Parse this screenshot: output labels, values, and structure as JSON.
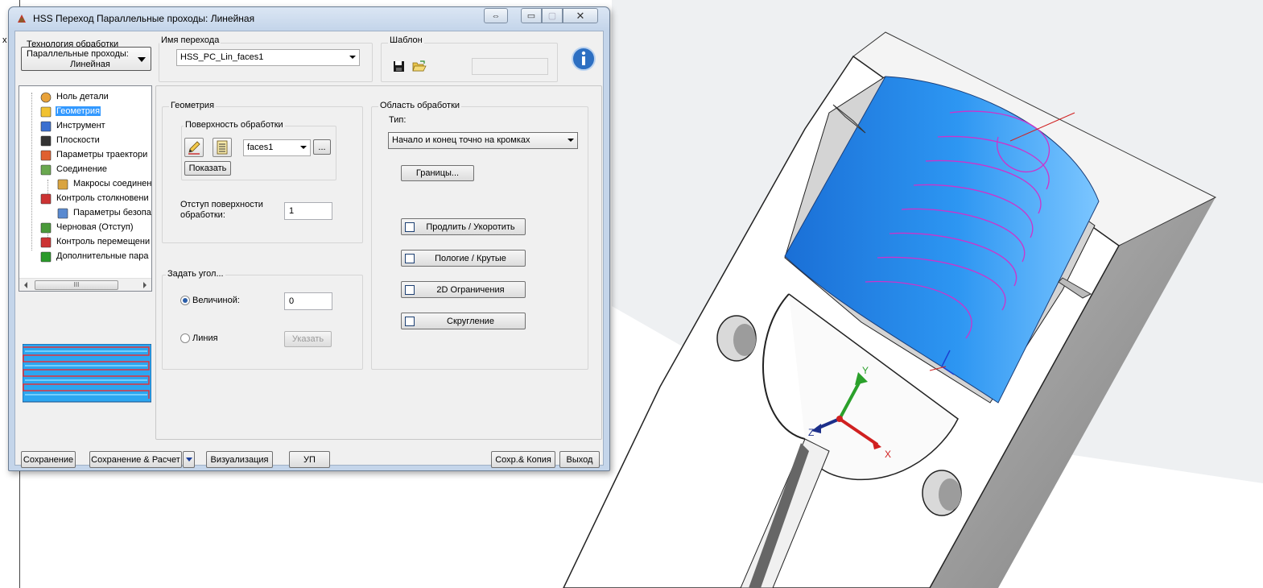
{
  "window": {
    "title": "HSS Переход Параллельные проходы: Линейная",
    "resize_glyph": "⇔",
    "minimize_glyph": "▭",
    "maximize_glyph": "▢",
    "close_glyph": "✕"
  },
  "technology": {
    "label": "Технология обработки",
    "value_line1": "Параллельные проходы:",
    "value_line2": "Линейная"
  },
  "operation_name": {
    "label": "Имя перехода",
    "value": "HSS_PC_Lin_faces1"
  },
  "template": {
    "label": "Шаблон",
    "save_icon": "floppy-disk-icon",
    "open_icon": "open-folder-icon",
    "field_value": ""
  },
  "info_icon": "info-icon",
  "tree": {
    "items": [
      {
        "label": "Ноль детали",
        "icon": "part-origin-icon",
        "selected": false
      },
      {
        "label": "Геометрия",
        "icon": "geometry-icon",
        "selected": true
      },
      {
        "label": "Инструмент",
        "icon": "tool-icon",
        "selected": false
      },
      {
        "label": "Плоскости",
        "icon": "planes-icon",
        "selected": false
      },
      {
        "label": "Параметры траектори",
        "icon": "toolpath-params-icon",
        "selected": false
      },
      {
        "label": "Соединение",
        "icon": "links-icon",
        "selected": false
      },
      {
        "label": "Макросы соединен",
        "icon": "link-macros-icon",
        "selected": false
      },
      {
        "label": "Контроль столкновени",
        "icon": "collision-control-icon",
        "selected": false
      },
      {
        "label": "Параметры безопа",
        "icon": "safety-params-icon",
        "selected": false
      },
      {
        "label": "Черновая (Отступ)",
        "icon": "roughing-icon",
        "selected": false
      },
      {
        "label": "Контроль перемещени",
        "icon": "move-control-icon",
        "selected": false
      },
      {
        "label": "Дополнительные пара",
        "icon": "additional-params-icon",
        "selected": false
      }
    ],
    "scroll_thumb": "III"
  },
  "geometry": {
    "group_label": "Геометрия",
    "surface_group_label": "Поверхность обработки",
    "edit_icon": "pencil-icon",
    "list_icon": "list-icon",
    "surface_value": "faces1",
    "ellipsis": "...",
    "show_button": "Показать",
    "offset_label_1": "Отступ поверхности",
    "offset_label_2": "обработки:",
    "offset_value": "1"
  },
  "angle": {
    "group_label": "Задать угол...",
    "by_value_label": "Величиной:",
    "by_value_selected": true,
    "value": "0",
    "by_line_label": "Линия",
    "pick_button": "Указать"
  },
  "area": {
    "group_label": "Область обработки",
    "type_label": "Тип:",
    "type_value": "Начало и конец точно на кромках",
    "bounds_button": "Границы...",
    "options": [
      {
        "label": "Продлить / Укоротить",
        "checked": false
      },
      {
        "label": "Пологие / Крутые",
        "checked": false
      },
      {
        "label": "2D Ограничения",
        "checked": false
      },
      {
        "label": "Скругление",
        "checked": false
      }
    ]
  },
  "footer": {
    "save": "Сохранение",
    "save_calc": "Сохранение & Расчет",
    "visualize": "Визуализация",
    "nc": "УП",
    "save_copy": "Сохр.& Копия",
    "exit": "Выход"
  },
  "cad": {
    "axis_x": "X",
    "axis_y": "Y",
    "axis_z": "Z",
    "edge_label": "x"
  },
  "colors": {
    "surface_blue": "#1f7fe0",
    "toolpath": "#cc33cc",
    "selection": "#3399ff"
  }
}
